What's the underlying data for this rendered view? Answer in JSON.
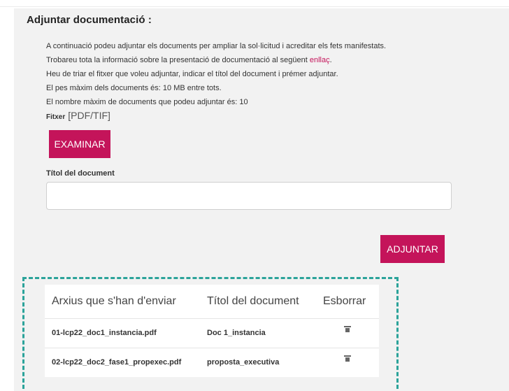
{
  "section": {
    "title": "Adjuntar documentació :"
  },
  "intro": {
    "line1": "A continuació podeu adjuntar els documents per ampliar la sol·licitud i acreditar els fets manifestats.",
    "line2_prefix": "Trobareu tota la informació sobre la presentació de documentació al següent ",
    "line2_link": "enllaç",
    "line2_suffix": ".",
    "line3": "Heu de triar el fitxer que voleu adjuntar, indicar el títol del document i prémer adjuntar.",
    "line4": "El pes màxim dels documents és: 10 MB entre tots.",
    "line5": "El nombre màxim de documents que podeu adjuntar és: 10"
  },
  "fitxer": {
    "label": "Fitxer",
    "types": "[PDF/TIF]"
  },
  "buttons": {
    "examinar": "EXAMINAR",
    "adjuntar": "ADJUNTAR"
  },
  "titol": {
    "label": "Títol del document",
    "value": ""
  },
  "table": {
    "headers": [
      "Arxius que s'han d'enviar",
      "Títol del document",
      "Esborrar"
    ],
    "rows": [
      {
        "file": "01-lcp22_doc1_instancia.pdf",
        "title": "Doc 1_instancia",
        "icon": "trash-icon"
      },
      {
        "file": "02-lcp22_doc2_fase1_propexec.pdf",
        "title": "proposta_executiva",
        "icon": "trash-icon"
      }
    ]
  },
  "colors": {
    "accent": "#c4145a",
    "dashed_highlight": "#2ba39a",
    "panel_bg": "#f2f2f2"
  }
}
